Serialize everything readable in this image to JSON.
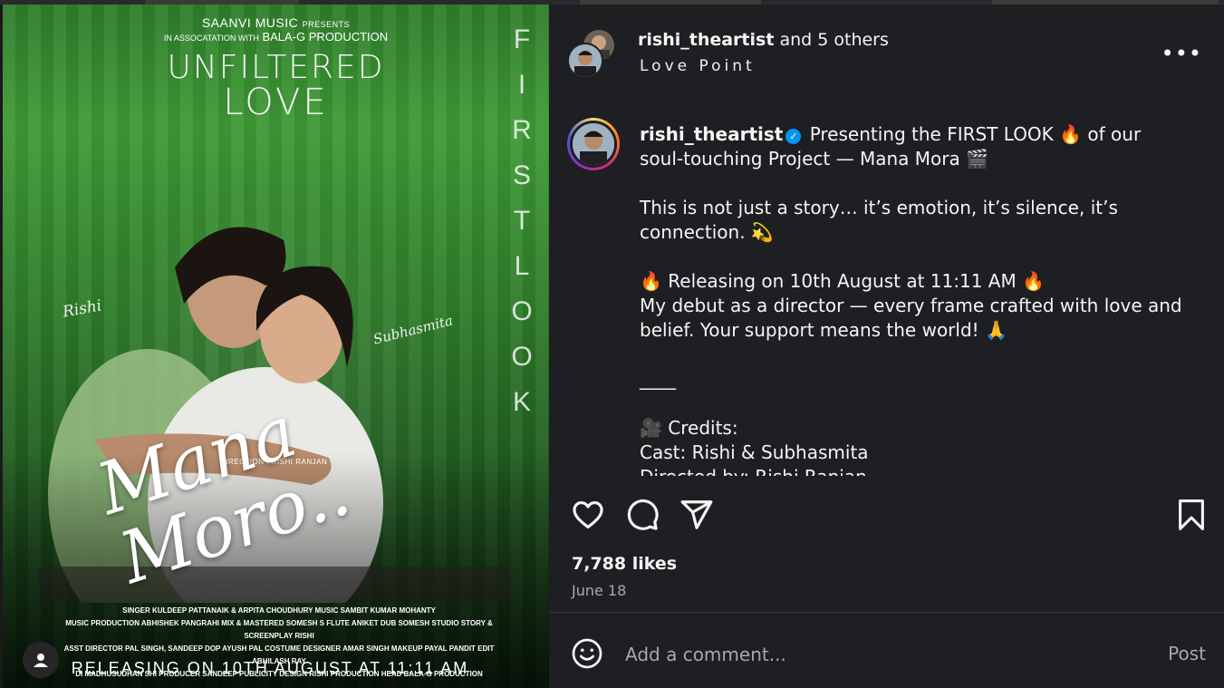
{
  "poster": {
    "presenter": "SAANVI MUSIC",
    "presents": "PRESENTS",
    "assoc_prefix": "IN ASSOCATATION WITH",
    "assoc_name": "BALA-G PRODUCTION",
    "subtitle_line1": "UNFILTERED",
    "subtitle_line2": "LOVE",
    "first_look": [
      "F",
      "I",
      "R",
      "S",
      "T",
      "L",
      "O",
      "O",
      "K"
    ],
    "tag_left": "Rishi",
    "tag_right": "Subhasmita",
    "direction": "DIRECTION : RISHI RANJAN",
    "title": "Mana Moro..",
    "credits_line1": "SINGER KULDEEP PATTANAIK & ARPITA CHOUDHURY   MUSIC SAMBIT KUMAR MOHANTY",
    "credits_line2": "MUSIC PRODUCTION ABHISHEK PANGRAHI   MIX & MASTERED SOMESH S   FLUTE ANIKET   DUB SOMESH STUDIO   STORY & SCREENPLAY RISHI",
    "credits_line3": "ASST DIRECTOR PAL SINGH, SANDEEP   DOP AYUSH PAL   COSTUME DESIGNER AMAR SINGH   MAKEUP PAYAL PANDIT   EDIT ABHILASH RAY",
    "credits_line4": "DI MADHUSUDHAN SHI   PRODUCER SANDEEP   PUBLICITY DESIGN RISHI   PRODUCTION HEAD BALA-G PRODUCTION",
    "release": "RELEASING ON 10TH AUGUST AT 11:11 AM"
  },
  "header": {
    "username": "rishi_theartist",
    "others": "and 5 others",
    "location": "Love Point",
    "more": "•••"
  },
  "caption": {
    "username": "rishi_theartist",
    "line1": "Presenting the FIRST LOOK 🔥 of our soul-touching Project — Mana Mora 🎬",
    "line2": "This is not just a story… it’s emotion, it’s silence, it’s connection. 💫",
    "line3": "🔥 Releasing on 10th August at 11:11 AM 🔥",
    "line4": "My debut as a director — every frame crafted with love and belief. Your support means the world! 🙏",
    "divider": "____",
    "credits_heading": "🎥 Credits:",
    "cast": "Cast: Rishi & Subhasmita",
    "directed": "Directed by: Rishi Ranjan"
  },
  "engagement": {
    "likes": "7,788 likes",
    "date": "June 18"
  },
  "comment": {
    "placeholder": "Add a comment...",
    "post_label": "Post"
  },
  "colors": {
    "panel_bg": "#1e1f22",
    "verified": "#0095f6",
    "muted": "#a8a8a8"
  }
}
